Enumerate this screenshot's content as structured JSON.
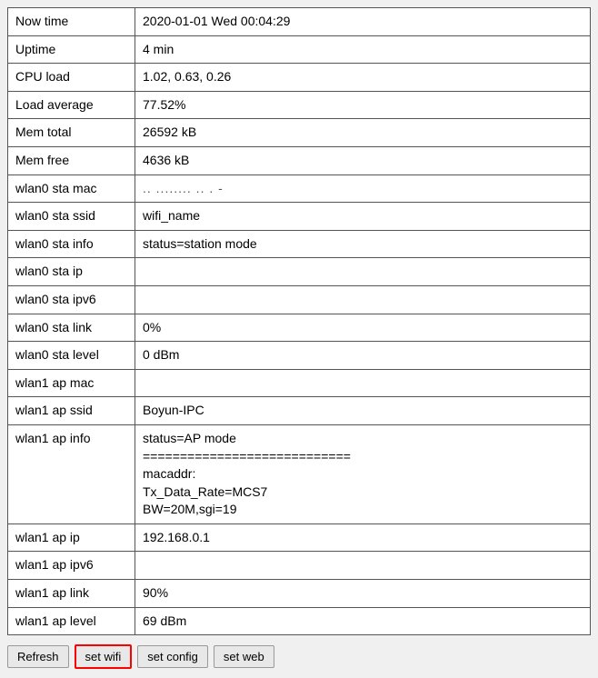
{
  "table": {
    "rows": [
      {
        "label": "Now time",
        "value": "2020-01-01 Wed 00:04:29",
        "type": "normal"
      },
      {
        "label": "Uptime",
        "value": "4 min",
        "type": "normal"
      },
      {
        "label": "CPU load",
        "value": "1.02, 0.63, 0.26",
        "type": "normal"
      },
      {
        "label": "Load average",
        "value": "77.52%",
        "type": "normal"
      },
      {
        "label": "Mem total",
        "value": "26592 kB",
        "type": "normal"
      },
      {
        "label": "Mem free",
        "value": "4636 kB",
        "type": "normal"
      },
      {
        "label": "wlan0 sta mac",
        "value": ".. ........ .. . -",
        "type": "mac"
      },
      {
        "label": "wlan0 sta ssid",
        "value": "wifi_name",
        "type": "normal"
      },
      {
        "label": "wlan0 sta info",
        "value": "status=station mode",
        "type": "normal"
      },
      {
        "label": "wlan0 sta ip",
        "value": "",
        "type": "normal"
      },
      {
        "label": "wlan0 sta ipv6",
        "value": "",
        "type": "normal"
      },
      {
        "label": "wlan0 sta link",
        "value": "0%",
        "type": "normal"
      },
      {
        "label": "wlan0 sta level",
        "value": "0 dBm",
        "type": "normal"
      },
      {
        "label": "wlan1 ap mac",
        "value": "",
        "type": "normal"
      },
      {
        "label": "wlan1 ap ssid",
        "value": "Boyun-IPC",
        "type": "normal"
      },
      {
        "label": "wlan1 ap info",
        "value": "status=AP mode\n============================\nmacaddr:\nTx_Data_Rate=MCS7\nBW=20M,sgi=19",
        "type": "multiline"
      },
      {
        "label": "wlan1 ap ip",
        "value": "192.168.0.1",
        "type": "normal"
      },
      {
        "label": "wlan1 ap ipv6",
        "value": "",
        "type": "normal"
      },
      {
        "label": "wlan1 ap link",
        "value": "90%",
        "type": "normal"
      },
      {
        "label": "wlan1 ap level",
        "value": "69 dBm",
        "type": "normal"
      }
    ]
  },
  "buttons": [
    {
      "label": "Refresh",
      "name": "refresh-button",
      "highlight": false
    },
    {
      "label": "set wifi",
      "name": "set-wifi-button",
      "highlight": true
    },
    {
      "label": "set config",
      "name": "set-config-button",
      "highlight": false
    },
    {
      "label": "set web",
      "name": "set-web-button",
      "highlight": false
    }
  ]
}
